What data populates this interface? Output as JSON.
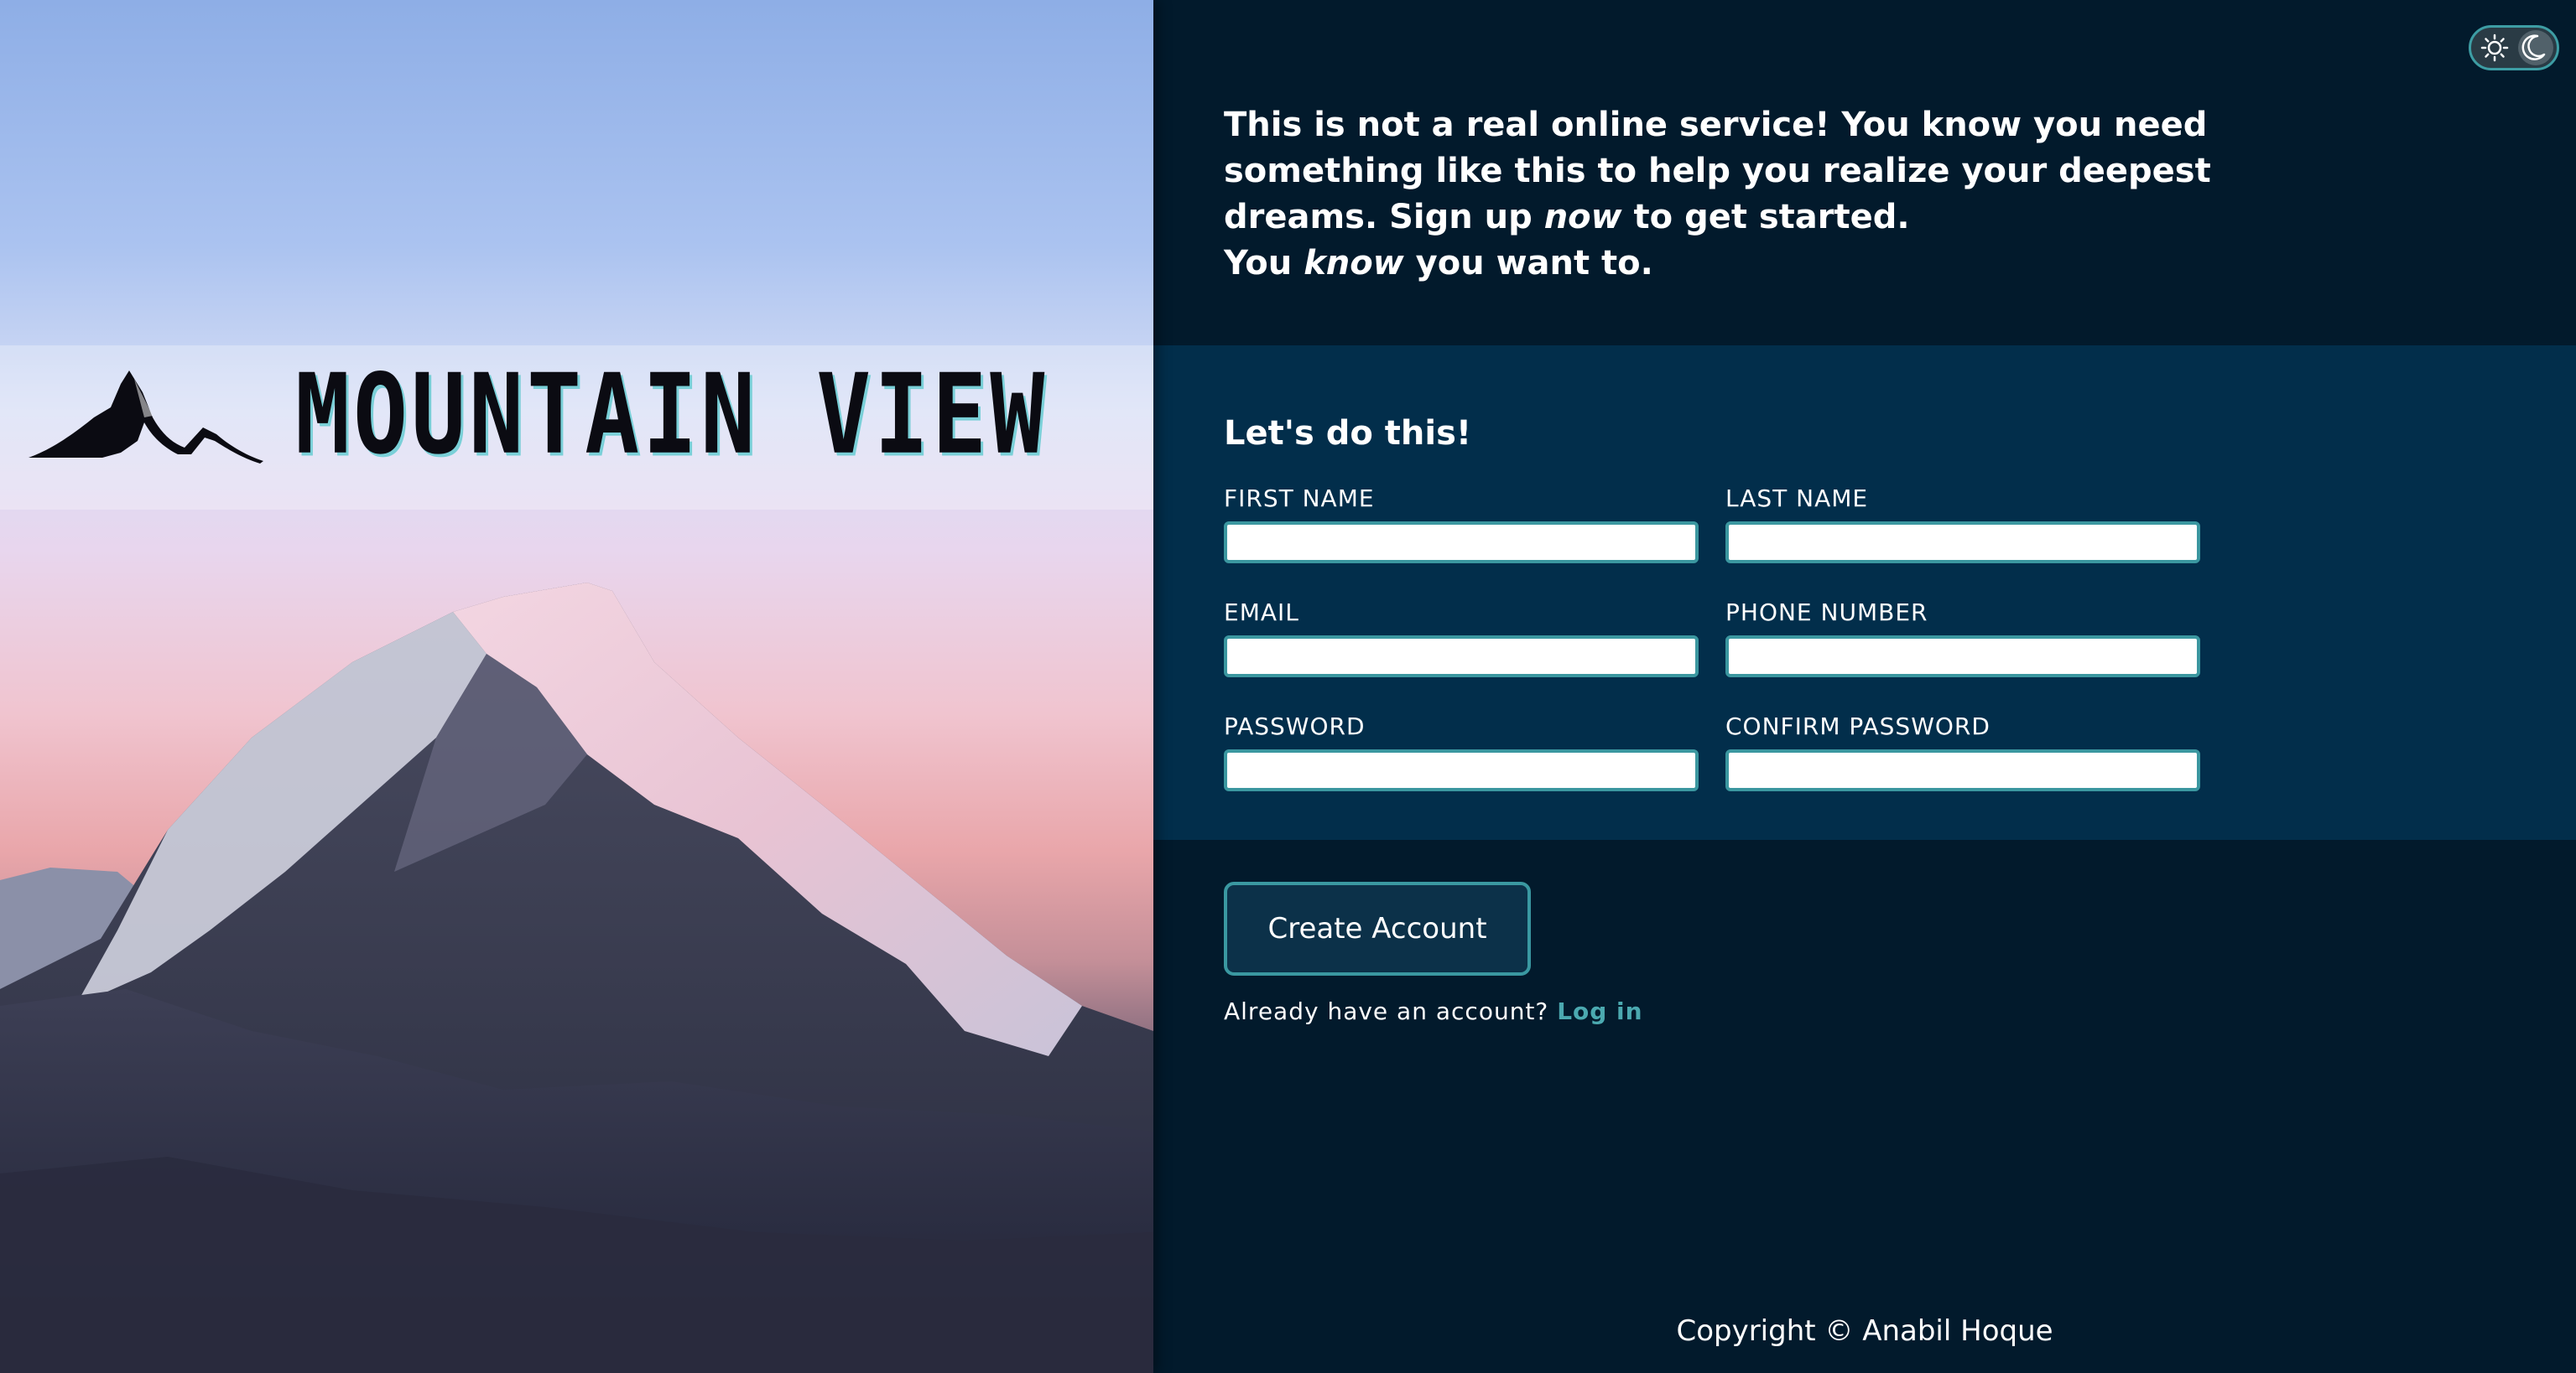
{
  "brand": {
    "name": "MOUNTAIN VIEW",
    "logo_icon": "mountain-logo-icon"
  },
  "theme_toggle": {
    "light_icon": "sun-icon",
    "dark_icon": "moon-icon",
    "active": "dark"
  },
  "intro": {
    "line1_a": "This is not a real online service! You know you need something like this to help you realize your deepest dreams. Sign up ",
    "line1_em": "now",
    "line1_b": " to get started.",
    "line2_a": "You ",
    "line2_em": "know",
    "line2_b": " you want to."
  },
  "form": {
    "title": "Let's do this!",
    "fields": {
      "first_name": {
        "label": "FIRST NAME",
        "value": "",
        "placeholder": ""
      },
      "last_name": {
        "label": "LAST NAME",
        "value": "",
        "placeholder": ""
      },
      "email": {
        "label": "EMAIL",
        "value": "",
        "placeholder": ""
      },
      "phone": {
        "label": "PHONE NUMBER",
        "value": "",
        "placeholder": ""
      },
      "password": {
        "label": "PASSWORD",
        "value": "",
        "placeholder": ""
      },
      "confirm_password": {
        "label": "CONFIRM PASSWORD",
        "value": "",
        "placeholder": ""
      }
    },
    "submit_label": "Create Account"
  },
  "login": {
    "prompt": "Already have an account?",
    "link_label": "Log in"
  },
  "footer": {
    "copyright": "Copyright © Anabil Hoque"
  },
  "colors": {
    "panel_bg": "#021a2c",
    "form_band_bg": "#022e4b",
    "accent": "#3b97a0",
    "link": "#4ba9b0"
  }
}
